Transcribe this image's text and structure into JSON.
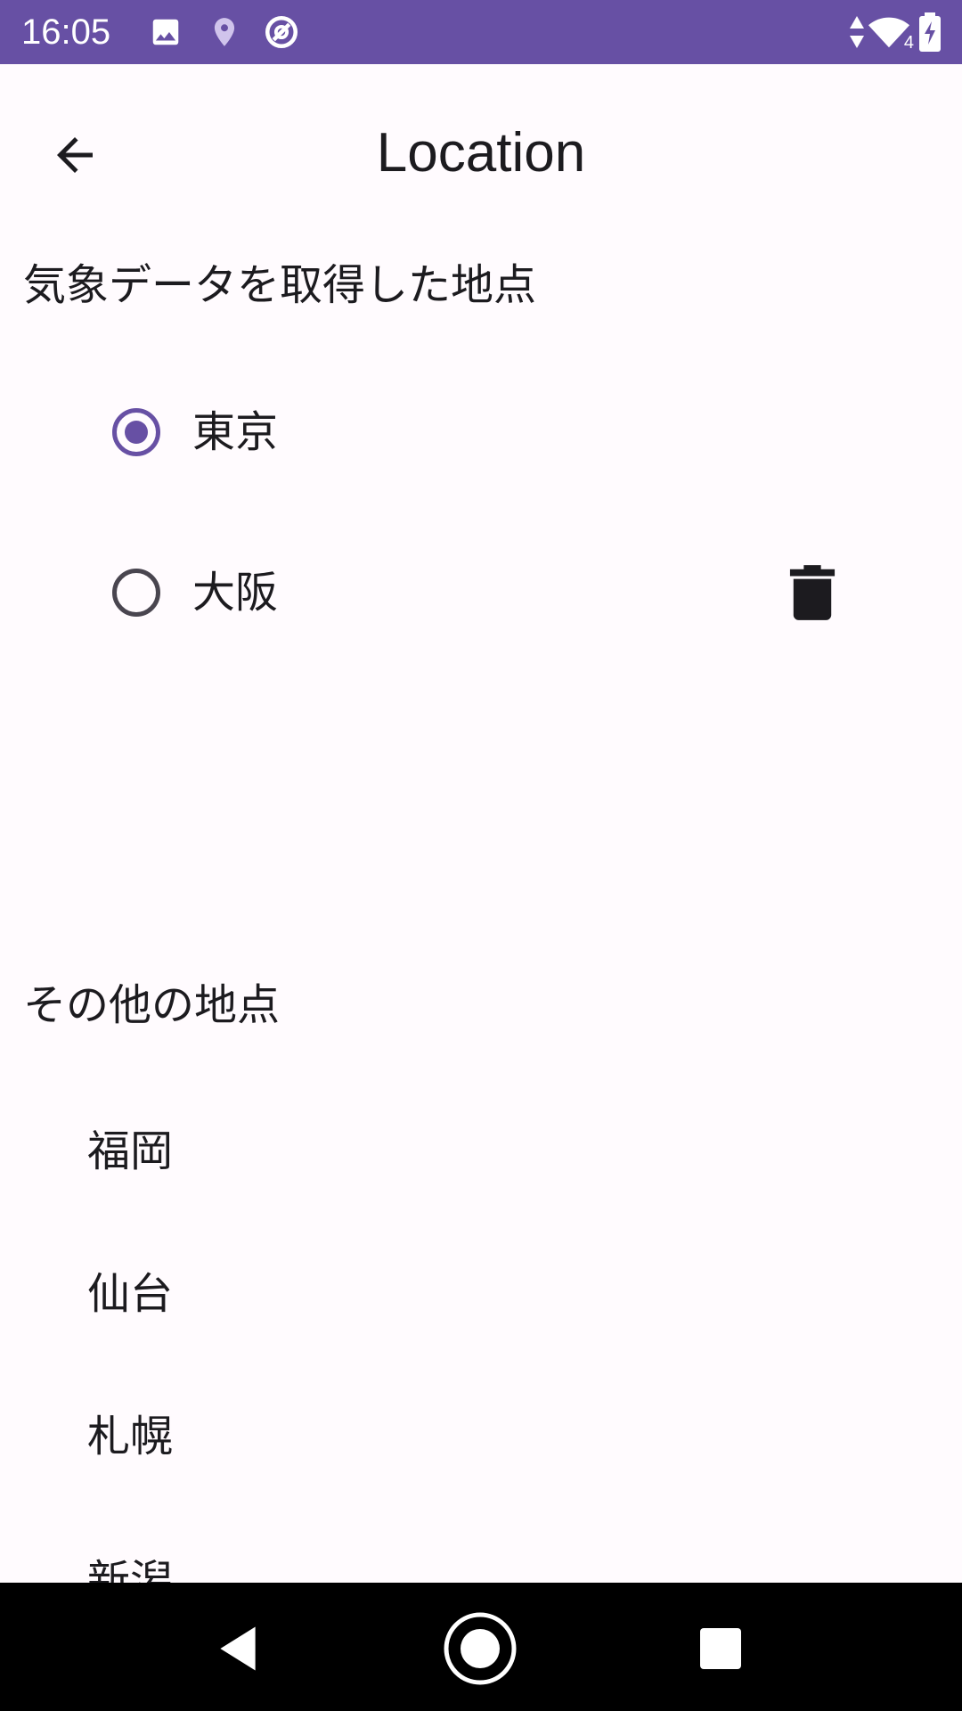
{
  "status_bar": {
    "time": "16:05",
    "icons": [
      "image-icon",
      "location-pin-icon",
      "sync-icon",
      "signal-icon",
      "wifi-icon",
      "battery-charging-icon"
    ],
    "wifi_badge": "4"
  },
  "app_bar": {
    "title": "Location",
    "back_icon": "arrow-back-icon"
  },
  "saved_section": {
    "header": "気象データを取得した地点",
    "items": [
      {
        "label": "東京",
        "selected": true,
        "deletable": false
      },
      {
        "label": "大阪",
        "selected": false,
        "deletable": true
      }
    ]
  },
  "other_section": {
    "header": "その他の地点",
    "items": [
      "福岡",
      "仙台",
      "札幌",
      "新潟"
    ]
  },
  "nav_bar": {
    "icons": [
      "nav-back-icon",
      "nav-home-icon",
      "nav-recents-icon"
    ]
  },
  "colors": {
    "accent": "#6750A4",
    "background": "#FFFBFE",
    "text": "#1C1B1F",
    "outline": "#49454F"
  }
}
